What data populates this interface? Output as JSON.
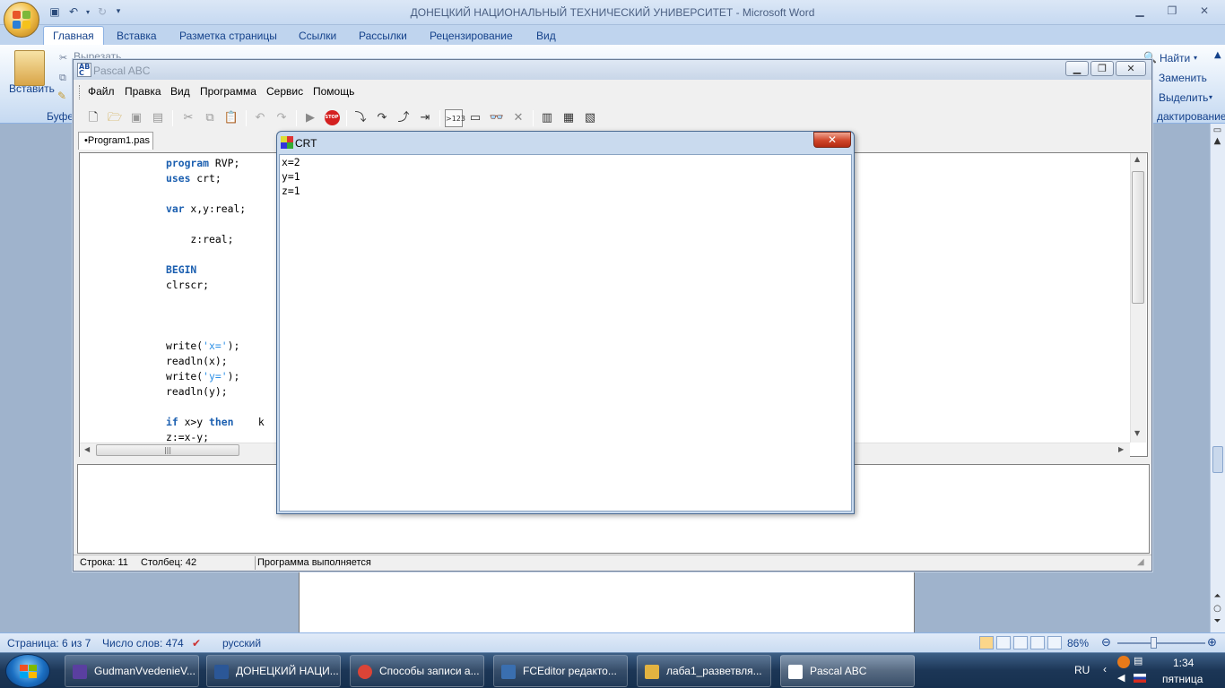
{
  "word": {
    "window_title": "ДОНЕЦКИЙ НАЦИОНАЛЬНЫЙ ТЕХНИЧЕСКИЙ УНИВЕРСИТЕТ - Microsoft Word",
    "tabs": [
      "Главная",
      "Вставка",
      "Разметка страницы",
      "Ссылки",
      "Рассылки",
      "Рецензирование",
      "Вид"
    ],
    "ribbon": {
      "paste": "Вставить",
      "cut": "Вырезать",
      "clipboard_group": "Буфер",
      "find": "Найти",
      "replace": "Заменить",
      "select": "Выделить",
      "editing_group": "дактирование"
    },
    "status": {
      "page": "Страница: 6 из 7",
      "words": "Число слов: 474",
      "language": "русский",
      "zoom": "86%"
    }
  },
  "pascal": {
    "window_title": "Pascal ABC",
    "menu": [
      "Файл",
      "Правка",
      "Вид",
      "Программа",
      "Сервис",
      "Помощь"
    ],
    "file_tab": "•Program1.pas",
    "status": {
      "line": "Строка: 11",
      "column": "Столбец: 42",
      "state": "Программа выполняется"
    }
  },
  "code": [
    [
      {
        "t": "program",
        "k": "kw"
      },
      {
        "t": " RVP;"
      }
    ],
    [
      {
        "t": "uses",
        "k": "kw"
      },
      {
        "t": " crt;"
      }
    ],
    [],
    [
      {
        "t": "var",
        "k": "kw"
      },
      {
        "t": " x,y:real;"
      }
    ],
    [],
    [
      {
        "t": "    z:real;"
      }
    ],
    [],
    [
      {
        "t": "BEGIN",
        "k": "kw"
      }
    ],
    [
      {
        "t": "clrscr;"
      }
    ],
    [],
    [],
    [],
    [
      {
        "t": "write("
      },
      {
        "t": "'x='",
        "k": "str"
      },
      {
        "t": ");"
      }
    ],
    [
      {
        "t": "readln(x);"
      }
    ],
    [
      {
        "t": "write("
      },
      {
        "t": "'y='",
        "k": "str"
      },
      {
        "t": ");"
      }
    ],
    [
      {
        "t": "readln(y);"
      }
    ],
    [],
    [
      {
        "t": "if",
        "k": "kw"
      },
      {
        "t": " x>y "
      },
      {
        "t": "then",
        "k": "kw"
      },
      {
        "t": "    k"
      }
    ],
    [
      {
        "t": "z:=x-y;"
      }
    ]
  ],
  "crt": {
    "title": "CRT",
    "output": [
      "x=2",
      "y=1",
      "z=1"
    ]
  },
  "taskbar": {
    "items": [
      {
        "label": "GudmanVvedenieV...",
        "color": "#5a3fa0"
      },
      {
        "label": "ДОНЕЦКИЙ НАЦИ...",
        "color": "#2b5797"
      },
      {
        "label": "Способы записи а...",
        "color": "#db4437"
      },
      {
        "label": "FCEditor редакто...",
        "color": "#3a6fb0"
      },
      {
        "label": "лаба1_разветвля...",
        "color": "#e3b341"
      },
      {
        "label": "Pascal ABC",
        "color": "#ffffff"
      }
    ],
    "lang": "RU",
    "time": "1:34",
    "day": "пятница"
  }
}
